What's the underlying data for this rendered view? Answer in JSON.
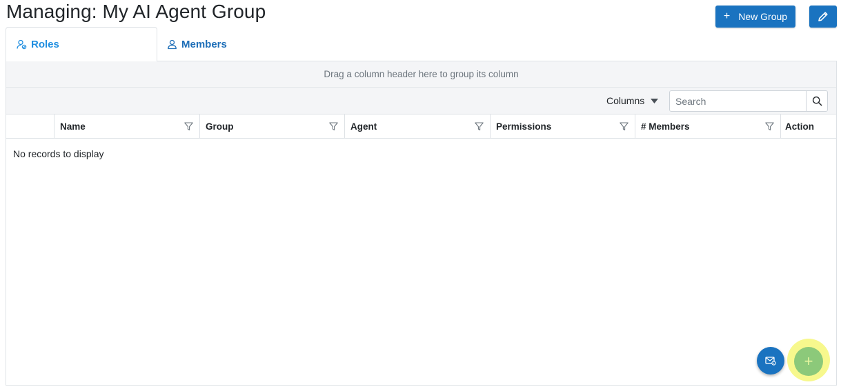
{
  "page": {
    "title": "Managing: My AI Agent Group"
  },
  "actions": {
    "new_group_label": "New Group",
    "new_group_icon": "plus-icon",
    "edit_icon": "pencil-icon"
  },
  "tabs": [
    {
      "label": "Roles",
      "icon": "roles-icon",
      "active": true
    },
    {
      "label": "Members",
      "icon": "person-icon",
      "active": false
    }
  ],
  "grid": {
    "group_panel_text": "Drag a column header here to group its column",
    "columns_label": "Columns",
    "search": {
      "placeholder": "Search",
      "value": ""
    },
    "headers": [
      "",
      "Name",
      "Group",
      "Agent",
      "Permissions",
      "# Members",
      "Action"
    ],
    "empty_text": "No records to display"
  },
  "fabs": {
    "mail_icon": "mail-settings-icon",
    "add_icon": "plus-icon"
  },
  "colors": {
    "primary": "#1a73c0",
    "tab_active": "#1f8ee0",
    "fab_add": "#8cc97a",
    "highlight": "#f2f550"
  }
}
